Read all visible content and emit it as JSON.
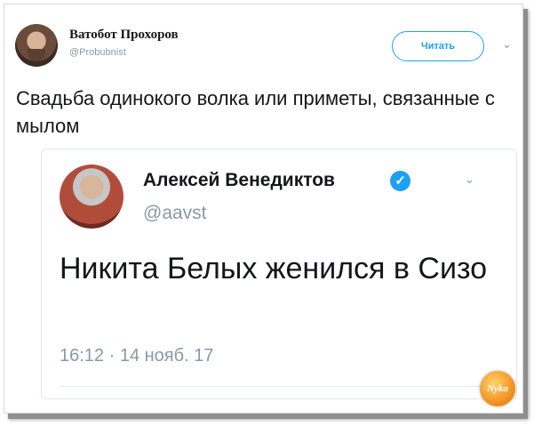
{
  "tweet": {
    "author_name": "Ватобот Прохоров",
    "author_handle": "@Probubnist",
    "follow_label": "Читать",
    "text": "Свадьба одинокого волка или приметы, связанные с мылом"
  },
  "quoted_tweet": {
    "author_name": "Алексей Венедиктов",
    "author_handle": "@aavst",
    "verified_glyph": "✓",
    "text": "Никита Белых женился в Сизо",
    "timestamp": "16:12 · 14 нояб. 17"
  },
  "icons": {
    "chevron": "⌄"
  },
  "watermark": "Nyka",
  "colors": {
    "accent": "#1da1f2",
    "muted": "#8899a6",
    "text": "#14171a",
    "border": "#e1e8ed"
  }
}
